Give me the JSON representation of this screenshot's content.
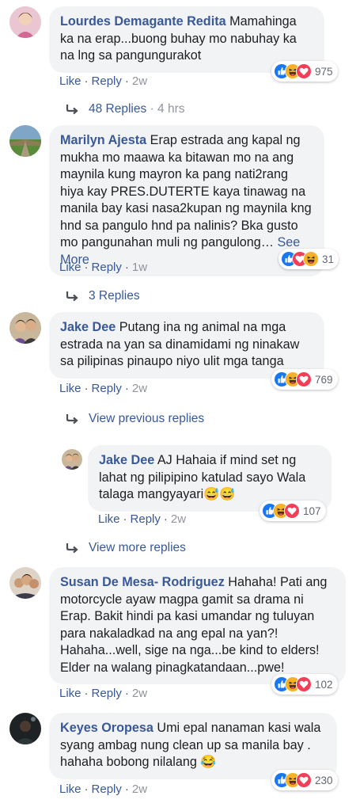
{
  "colors": {
    "link": "#385898",
    "bubble": "#f2f3f5",
    "meta": "#90949c",
    "like": "#1877f2",
    "haha": "#f7b125",
    "love": "#f33e58"
  },
  "comments": [
    {
      "name": "Lourdes Demagante Redita",
      "text": "Mamahinga ka na erap...buong buhay mo nabuhay ka na lng sa pangungurakot",
      "like": "Like",
      "reply": "Reply",
      "age": "2w",
      "reactions": [
        "like-icon",
        "haha-icon",
        "love-icon"
      ],
      "count": "975",
      "replies": {
        "label": "48 Replies",
        "when": "4 hrs"
      }
    },
    {
      "name": "Marilyn Ajesta",
      "text": "Erap estrada ang kapal ng mukha mo maawa ka bitawan mo na ang maynila kung mayron ka pang nati2rang hiya kay PRES.DUTERTE kaya tinawag na manila bay kasi nasa2kupan ng maynila kng hnd sa pangulo hnd pa nalinis? Bka gusto mo pangunahan muli ng pangulong…",
      "see_more": "See More",
      "like": "Like",
      "reply": "Reply",
      "age": "1w",
      "reactions": [
        "like-icon",
        "love-icon",
        "haha-icon"
      ],
      "count": "31",
      "replies": {
        "label": "3 Replies"
      }
    },
    {
      "name": "Jake Dee",
      "text": "Putang ina ng animal na mga estrada na yan sa dinamidami ng ninakaw sa pilipinas pinaupo niyo ulit mga tanga",
      "like": "Like",
      "reply": "Reply",
      "age": "2w",
      "reactions": [
        "like-icon",
        "haha-icon",
        "love-icon"
      ],
      "count": "769",
      "view_previous": "View previous replies"
    },
    {
      "name": "Jake Dee",
      "text": "AJ Hahaia if mind set ng lahat ng pilipipino katulad sayo Wala talaga mangyayari😅😅",
      "like": "Like",
      "reply": "Reply",
      "age": "2w",
      "reactions": [
        "like-icon",
        "haha-icon",
        "love-icon"
      ],
      "count": "107",
      "view_more": "View more replies"
    },
    {
      "name": "Susan De Mesa- Rodriguez",
      "text": "Hahaha! Pati ang motorcycle ayaw magpa gamit sa drama ni Erap. Bakit hindi pa kasi umandar ng tuluyan para nakaladkad na ang epal na yan?! Hahaha...well, sige na nga...be kind to elders! Elder na walang pinagkatandaan...pwe!",
      "like": "Like",
      "reply": "Reply",
      "age": "2w",
      "reactions": [
        "like-icon",
        "haha-icon",
        "love-icon"
      ],
      "count": "102"
    },
    {
      "name": "Keyes Oropesa",
      "text": "Umi epal nanaman kasi wala syang ambag nung clean up sa manila bay . hahaha bobong nilalang 😂",
      "like": "Like",
      "reply": "Reply",
      "age": "2w",
      "reactions": [
        "like-icon",
        "haha-icon",
        "love-icon"
      ],
      "count": "230"
    }
  ]
}
